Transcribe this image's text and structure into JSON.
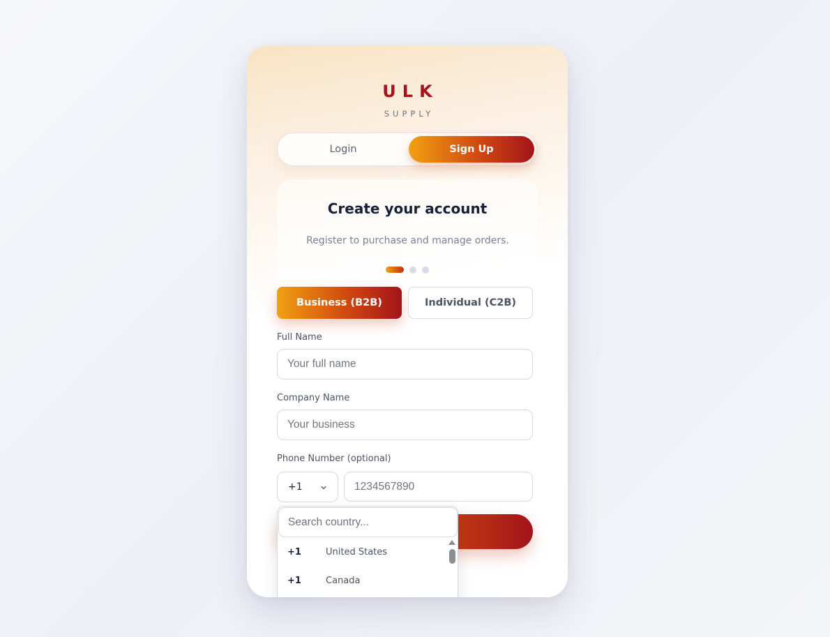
{
  "brand": {
    "logo": "ULK",
    "tagline": "SUPPLY"
  },
  "auth_tabs": {
    "login": "Login",
    "signup": "Sign Up",
    "active": "signup"
  },
  "form": {
    "title": "Create your account",
    "subtitle": "Register to purchase and manage orders.",
    "step": {
      "current": 1,
      "total": 3
    },
    "account_types": {
      "business": "Business (B2B)",
      "individual": "Individual (C2B)",
      "selected": "business"
    },
    "full_name": {
      "label": "Full Name",
      "placeholder": "Your full name",
      "value": ""
    },
    "company_name": {
      "label": "Company Name",
      "placeholder": "Your business",
      "value": ""
    },
    "phone": {
      "label": "Phone Number (optional)",
      "country_code": "+1",
      "placeholder": "1234567890",
      "value": ""
    }
  },
  "country_dropdown": {
    "search_placeholder": "Search country...",
    "items": [
      {
        "code": "+1",
        "name": "United States"
      },
      {
        "code": "+1",
        "name": "Canada"
      }
    ]
  },
  "colors": {
    "brand_red": "#a5121a",
    "gradient_start": "#f2a012",
    "gradient_end": "#a3131a",
    "title": "#162036"
  }
}
